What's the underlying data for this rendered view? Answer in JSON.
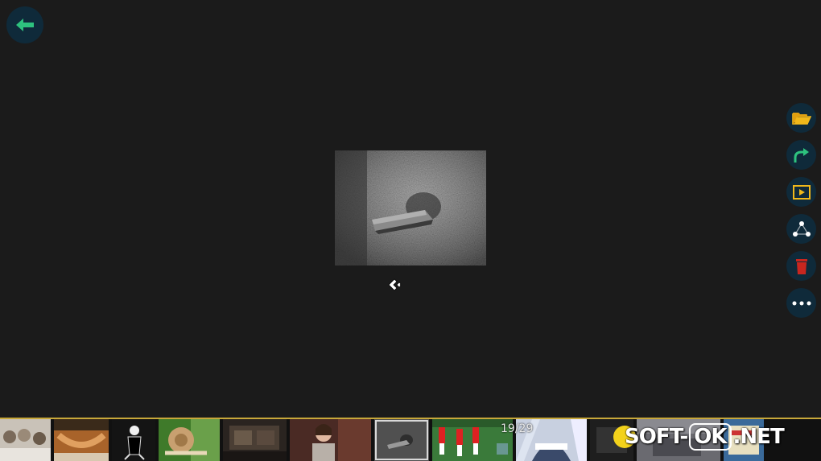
{
  "viewer": {
    "counter": "19/29",
    "watermark": {
      "part1": "SOFT-",
      "part2": "OK",
      "part3": ".NET"
    }
  },
  "icons": {
    "back": "arrow-left-icon",
    "tools": [
      "folder-open-icon",
      "rotate-icon",
      "slideshow-icon",
      "share-icon",
      "delete-icon",
      "more-icon"
    ],
    "cursor": "chevron-left-cursor-icon"
  },
  "filmstrip": {
    "total": 29,
    "current": 19,
    "thumbnails": [
      "kittens",
      "hammock",
      "cartoon-figure",
      "snail",
      "room-interior",
      "woman-portrait",
      "stone-texture",
      "football-players",
      "anime-character",
      "misc-1",
      "misc-2",
      "misc-3"
    ]
  },
  "colors": {
    "background": "#1b1b1b",
    "button_bg": "#0f2a3a",
    "accent_green": "#2ec27e",
    "folder_yellow": "#f0b81a",
    "delete_red": "#c8261f",
    "filmstrip_border": "#c8a83a"
  }
}
